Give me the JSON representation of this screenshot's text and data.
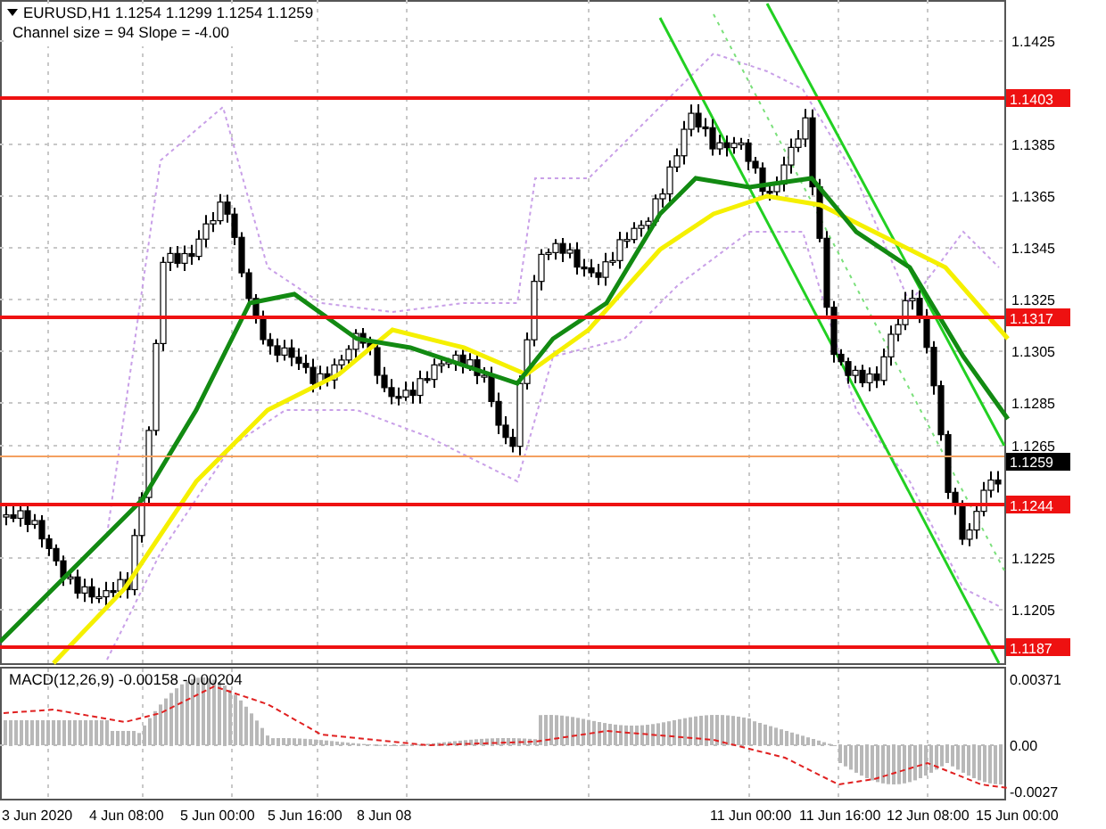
{
  "chart": {
    "title": "EURUSD,H1  1.1254 1.1299 1.1254 1.1259",
    "indicator": "Channel size = 94 Slope = -4.00",
    "price_ticks": [
      "1.1425",
      "1.1385",
      "1.1365",
      "1.1345",
      "1.1325",
      "1.1305",
      "1.1285",
      "1.1265",
      "1.1225",
      "1.1205"
    ],
    "levels": [
      {
        "label": "1.1403"
      },
      {
        "label": "1.1317"
      },
      {
        "label": "1.1244"
      },
      {
        "label": "1.1187"
      }
    ],
    "current_price": "1.1259"
  },
  "macd": {
    "title": "MACD(12,26,9) -0.00158 -0.00204",
    "ticks": [
      "0.00371",
      "0.00",
      "-0.0027"
    ]
  },
  "time_labels": [
    "3 Jun 2020",
    "4 Jun 08:00",
    "5 Jun 00:00",
    "5 Jun 16:00",
    "8 Jun 08",
    "11 Jun 00:00",
    "11 Jun 16:00",
    "12 Jun 08:00",
    "15 Jun 00:00"
  ]
}
